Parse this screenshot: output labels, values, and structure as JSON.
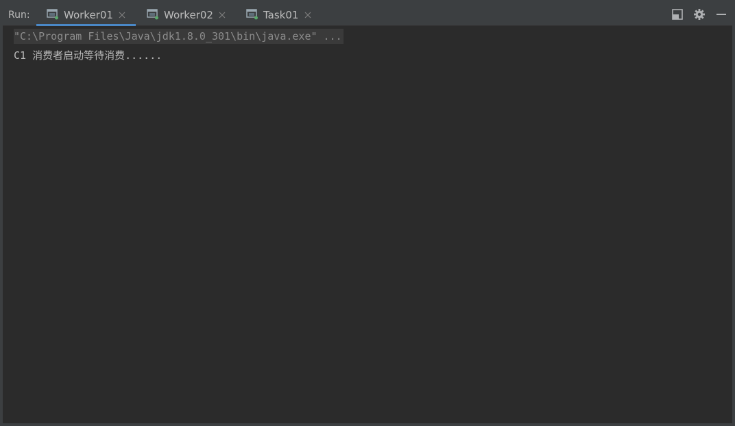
{
  "run_label": "Run:",
  "tabs": [
    {
      "label": "Worker01",
      "active": true,
      "icon": "run-config-icon"
    },
    {
      "label": "Worker02",
      "active": false,
      "icon": "run-config-icon"
    },
    {
      "label": "Task01",
      "active": false,
      "icon": "run-config-icon"
    }
  ],
  "toolbar_icons": [
    "layout-icon",
    "gear-icon",
    "minimize-icon"
  ],
  "console": {
    "command_line": "\"C:\\Program Files\\Java\\jdk1.8.0_301\\bin\\java.exe\" ...",
    "output_lines": [
      "C1 消费者启动等待消费......"
    ]
  },
  "colors": {
    "toolbar_bg": "#3c3f41",
    "console_bg": "#2b2b2b",
    "active_tab_underline": "#4a88c7",
    "running_indicator": "#59a869",
    "text": "#bbbbbb",
    "command_text": "#8c8c8c"
  }
}
